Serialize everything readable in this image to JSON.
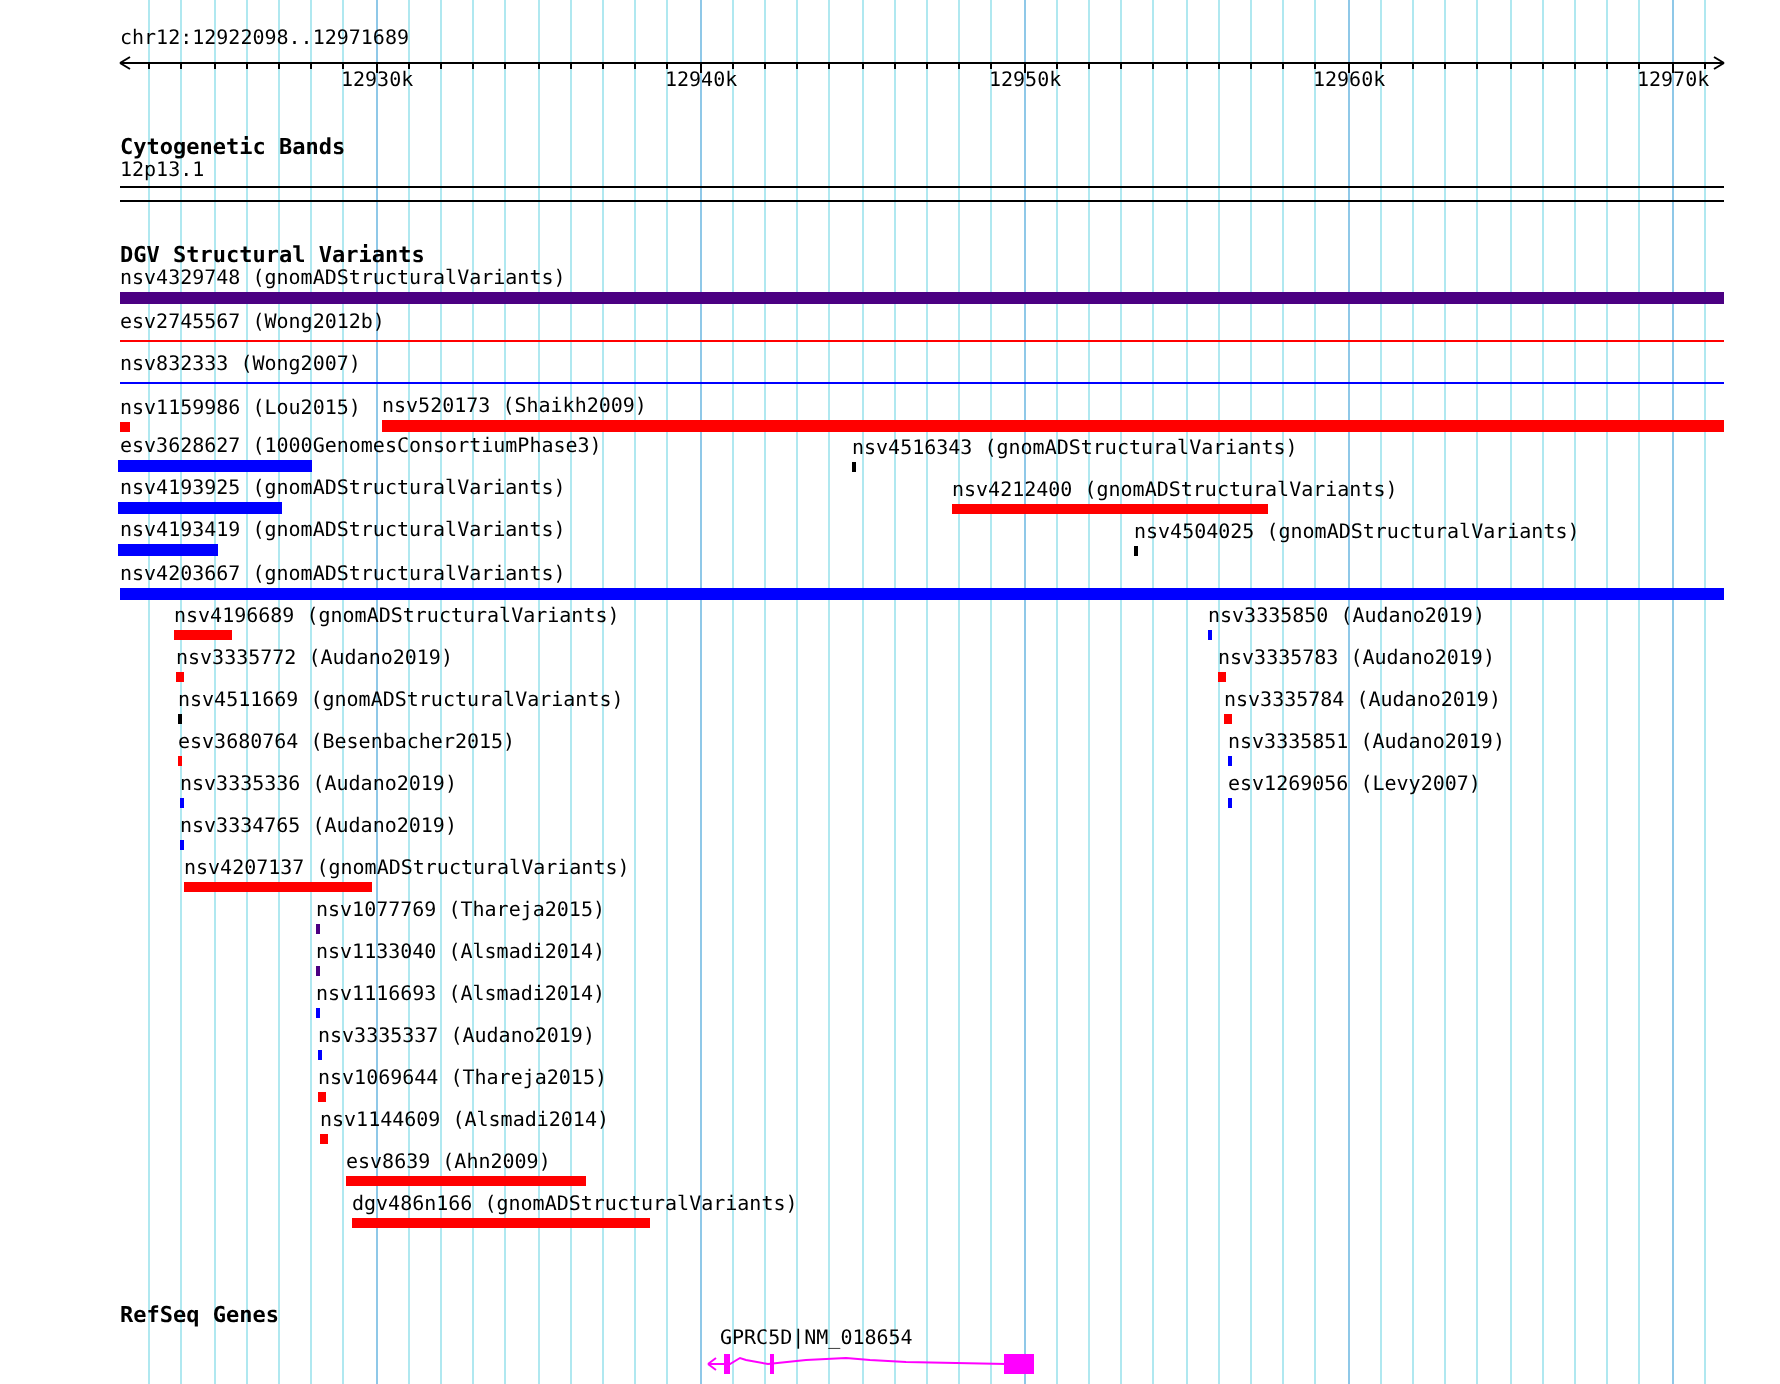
{
  "location": "chr12:12922098..12971689",
  "ruler": {
    "labels": [
      "12930k",
      "12940k",
      "12950k",
      "12960k",
      "12970k"
    ]
  },
  "cytogenetic_bands": {
    "title": "Cytogenetic Bands",
    "band": "12p13.1"
  },
  "dgv": {
    "title": "DGV Structural Variants",
    "features": [
      {
        "label": "nsv4329748 (gnomADStructuralVariants)",
        "color": "#4b0082"
      },
      {
        "label": "esv2745567 (Wong2012b)",
        "color": "#ff0000"
      },
      {
        "label": "nsv832333 (Wong2007)",
        "color": "#0000ff"
      },
      {
        "label": "nsv1159986 (Lou2015)",
        "color": "#ff0000"
      },
      {
        "label": "nsv520173 (Shaikh2009)",
        "color": "#ff0000"
      },
      {
        "label": "esv3628627 (1000GenomesConsortiumPhase3)",
        "color": "#0000ff"
      },
      {
        "label": "nsv4516343 (gnomADStructuralVariants)",
        "color": "#000000"
      },
      {
        "label": "nsv4193925 (gnomADStructuralVariants)",
        "color": "#0000ff"
      },
      {
        "label": "nsv4212400 (gnomADStructuralVariants)",
        "color": "#ff0000"
      },
      {
        "label": "nsv4193419 (gnomADStructuralVariants)",
        "color": "#0000ff"
      },
      {
        "label": "nsv4504025 (gnomADStructuralVariants)",
        "color": "#000000"
      },
      {
        "label": "nsv4203667 (gnomADStructuralVariants)",
        "color": "#0000ff"
      },
      {
        "label": "nsv4196689 (gnomADStructuralVariants)",
        "color": "#ff0000"
      },
      {
        "label": "nsv3335850 (Audano2019)",
        "color": "#0000ff"
      },
      {
        "label": "nsv3335772 (Audano2019)",
        "color": "#ff0000"
      },
      {
        "label": "nsv3335783 (Audano2019)",
        "color": "#ff0000"
      },
      {
        "label": "nsv4511669 (gnomADStructuralVariants)",
        "color": "#000000"
      },
      {
        "label": "nsv3335784 (Audano2019)",
        "color": "#ff0000"
      },
      {
        "label": "esv3680764 (Besenbacher2015)",
        "color": "#ff0000"
      },
      {
        "label": "nsv3335851 (Audano2019)",
        "color": "#0000ff"
      },
      {
        "label": "nsv3335336 (Audano2019)",
        "color": "#0000ff"
      },
      {
        "label": "esv1269056 (Levy2007)",
        "color": "#0000ff"
      },
      {
        "label": "nsv3334765 (Audano2019)",
        "color": "#0000ff"
      },
      {
        "label": "nsv4207137 (gnomADStructuralVariants)",
        "color": "#ff0000"
      },
      {
        "label": "nsv1077769 (Thareja2015)",
        "color": "#4b0082"
      },
      {
        "label": "nsv1133040 (Alsmadi2014)",
        "color": "#4b0082"
      },
      {
        "label": "nsv1116693 (Alsmadi2014)",
        "color": "#0000ff"
      },
      {
        "label": "nsv3335337 (Audano2019)",
        "color": "#0000ff"
      },
      {
        "label": "nsv1069644 (Thareja2015)",
        "color": "#ff0000"
      },
      {
        "label": "nsv1144609 (Alsmadi2014)",
        "color": "#ff0000"
      },
      {
        "label": "esv8639 (Ahn2009)",
        "color": "#ff0000"
      },
      {
        "label": "dgv486n166 (gnomADStructuralVariants)",
        "color": "#ff0000"
      }
    ]
  },
  "refseq": {
    "title": "RefSeq Genes",
    "genes": [
      {
        "label": "GPRC5D|NM_018654",
        "color": "#ff00ff"
      }
    ]
  }
}
